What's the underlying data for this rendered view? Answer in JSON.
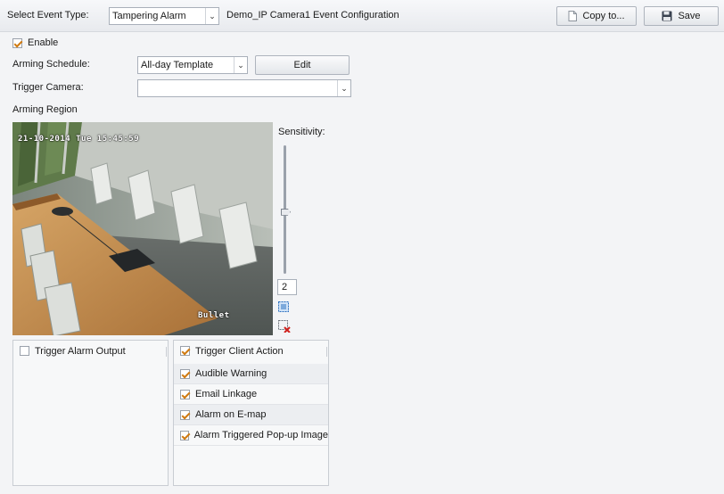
{
  "toolbar": {
    "event_type_label": "Select Event Type:",
    "event_type_value": "Tampering Alarm",
    "config_title": "Demo_IP Camera1 Event Configuration",
    "copy_label": "Copy to...",
    "save_label": "Save"
  },
  "form": {
    "enable_label": "Enable",
    "enable_checked": true,
    "schedule_label": "Arming Schedule:",
    "schedule_value": "All-day Template",
    "edit_label": "Edit",
    "trigger_camera_label": "Trigger Camera:",
    "trigger_camera_value": "",
    "arming_region_label": "Arming Region"
  },
  "video": {
    "timestamp": "21-10-2014 Tue 15:45:59",
    "camera_name": "Bullet"
  },
  "sensitivity": {
    "label": "Sensitivity:",
    "value": "2",
    "level_fraction": 0.48,
    "draw_area_icon": "draw-area-icon",
    "clear_area_icon": "clear-area-icon"
  },
  "alarm_output": {
    "header": "Trigger Alarm Output",
    "checked": false
  },
  "client_action": {
    "header": "Trigger Client Action",
    "checked": true,
    "items": [
      {
        "label": "Audible Warning",
        "checked": true
      },
      {
        "label": "Email Linkage",
        "checked": true
      },
      {
        "label": "Alarm on E-map",
        "checked": true
      },
      {
        "label": "Alarm Triggered Pop-up Image",
        "checked": true
      }
    ]
  },
  "colors": {
    "check_accent": "#d07a10",
    "clear_icon_red": "#d0201c",
    "draw_icon_blue": "#2a6fc0"
  }
}
